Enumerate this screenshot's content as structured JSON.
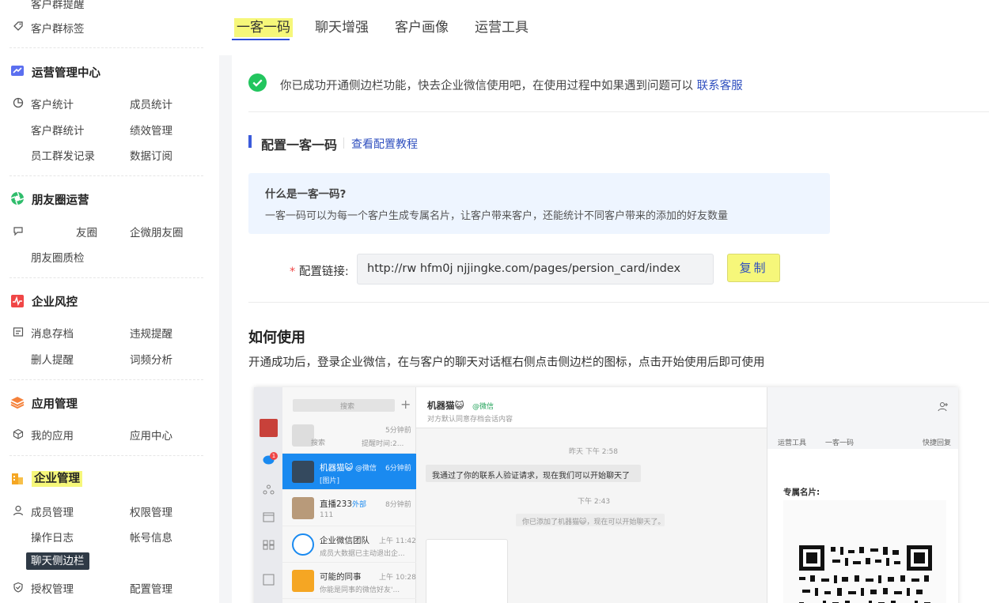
{
  "sidebar": {
    "top_cut": "客户群提醒",
    "group_tag": "客户群标签",
    "sections": [
      {
        "title": "运营管理中心",
        "items": [
          "客户统计",
          "成员统计",
          "客户群统计",
          "绩效管理",
          "员工群发记录",
          "数据订阅"
        ]
      },
      {
        "title": "朋友圈运营",
        "items": [
          "友圈",
          "企微朋友圈",
          "朋友圈质检"
        ]
      },
      {
        "title": "企业风控",
        "items": [
          "消息存档",
          "违规提醒",
          "删人提醒",
          "词频分析"
        ]
      },
      {
        "title": "应用管理",
        "items": [
          "我的应用",
          "应用中心"
        ]
      },
      {
        "title": "企业管理",
        "items": [
          "成员管理",
          "权限管理",
          "操作日志",
          "帐号信息",
          "聊天侧边栏",
          "授权管理",
          "配置管理"
        ]
      }
    ]
  },
  "tabs": [
    "一客一码",
    "聊天增强",
    "客户画像",
    "运营工具"
  ],
  "success": {
    "text": "你已成功开通侧边栏功能，快去企业微信使用吧，在使用过程中如果遇到问题可以",
    "link": "联系客服"
  },
  "config": {
    "title": "配置一客一码",
    "tutorial_link": "查看配置教程",
    "info_title": "什么是一客一码?",
    "info_desc": "一客一码可以为每一个客户生成专属名片，让客户带来客户，还能统计不同客户带来的添加的好友数量",
    "link_label": "配置链接:",
    "required_mark": "*",
    "link_value": "http://rw hfm0j  njjingke.com/pages/persion_card/index",
    "copy_label": "复制"
  },
  "howto": {
    "title": "如何使用",
    "desc": "开通成功后，登录企业微信，在与客户的聊天对话框右侧点击侧边栏的图标，点击开始使用后即可使用"
  },
  "screenshot": {
    "search_placeholder": "搜索",
    "search_placeholder2": "搜索",
    "conv0_time": "5分钟前",
    "conv0_preview": "提醒时间:2...",
    "conv1_name": "机器猫😺",
    "conv1_tag": "@微信",
    "conv1_time": "6分钟前",
    "conv1_preview": "[图片]",
    "conv2_name": "直播233",
    "conv2_badge": "外部",
    "conv2_time": "8分钟前",
    "conv2_preview": "111",
    "conv3_name": "企业微信团队",
    "conv3_time": "上午 11:42",
    "conv3_preview": "成员大数据已主动退出企...",
    "conv4_name": "可能的同事",
    "conv4_time": "上午 10:28",
    "conv4_preview": "你能是同事的微信好友'...",
    "chat_name": "机器猫😺",
    "chat_tag": "@微信",
    "chat_sub": "对方默认同意存档会话内容",
    "time1": "昨天 下午 2:58",
    "msg1": "我通过了你的联系人验证请求，现在我们可以开始聊天了",
    "time2": "下午 2:43",
    "sys_msg": "你已添加了机器猫😺，现在可以开始聊天了。",
    "side_tab1": "运营工具",
    "side_tab2": "一客一码",
    "side_tab3": "快捷回复",
    "card_label": "专属名片:",
    "unread": "1"
  }
}
